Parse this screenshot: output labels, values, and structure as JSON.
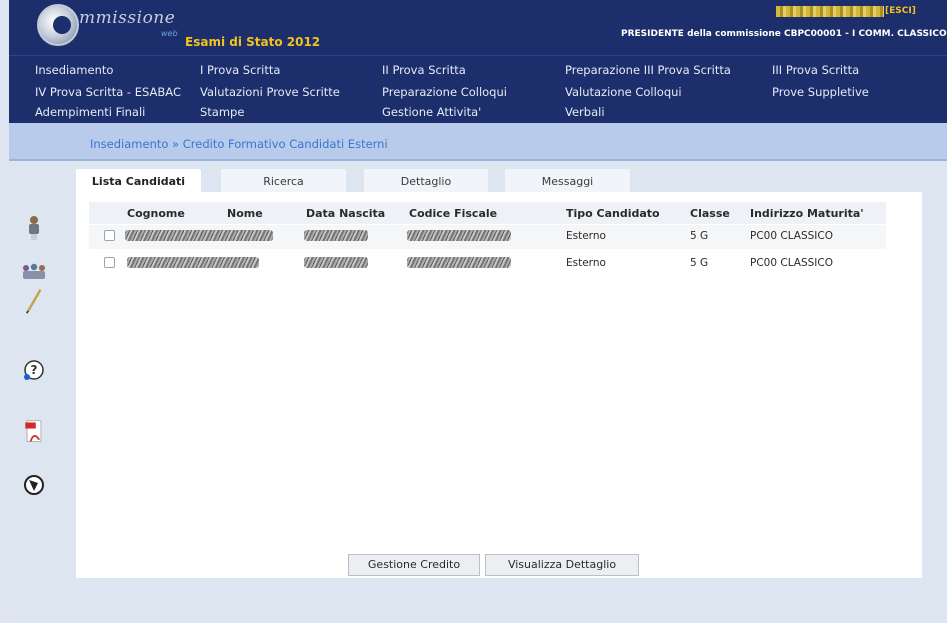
{
  "header": {
    "logo_text": "mmissione",
    "logo_sub": "web",
    "exam_title": "Esami di Stato 2012",
    "esci": "[ESCI]",
    "role_line": "PRESIDENTE della commissione CBPC00001 - I COMM. CLASSICO"
  },
  "menu": {
    "items": [
      "Insediamento",
      "I Prova Scritta",
      "II Prova Scritta",
      "Preparazione III Prova Scritta",
      "III Prova Scritta",
      "IV Prova Scritta - ESABAC",
      "Valutazioni Prove Scritte",
      "Preparazione Colloqui",
      "Valutazione Colloqui",
      "Prove Suppletive",
      "Adempimenti Finali",
      "Stampe",
      "Gestione Attivita'",
      "Verbali"
    ]
  },
  "breadcrumb": "Insediamento » Credito Formativo Candidati Esterni",
  "tabs": [
    "Lista Candidati",
    "Ricerca",
    "Dettaglio",
    "Messaggi"
  ],
  "table": {
    "headers": [
      "Cognome",
      "Nome",
      "Data Nascita",
      "Codice Fiscale",
      "Tipo Candidato",
      "Classe",
      "Indirizzo Maturita'"
    ],
    "rows": [
      {
        "tipo": "Esterno",
        "classe": "5 G",
        "indirizzo": "PC00 CLASSICO"
      },
      {
        "tipo": "Esterno",
        "classe": "5 G",
        "indirizzo": "PC00 CLASSICO"
      }
    ]
  },
  "buttons": {
    "gestione_credito": "Gestione Credito",
    "visualizza_dettaglio": "Visualizza Dettaglio"
  },
  "icons": {
    "sidebar": [
      "person-icon",
      "group-icon",
      "pen-icon",
      "help-icon",
      "pdf-icon",
      "globe-icon"
    ]
  },
  "colors": {
    "header_bg": "#1c2e6b",
    "accent_yellow": "#f2c21d",
    "breadcrumb_link": "#3a74d0"
  }
}
